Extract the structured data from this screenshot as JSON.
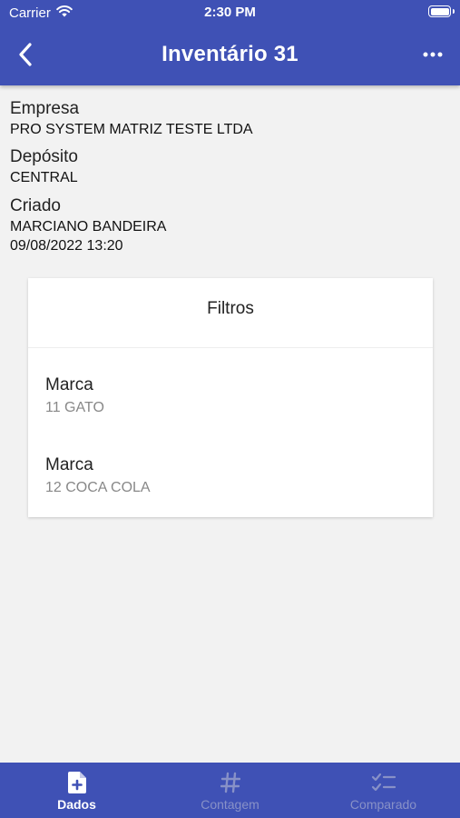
{
  "status_bar": {
    "carrier": "Carrier",
    "time": "2:30 PM"
  },
  "header": {
    "title": "Inventário 31",
    "back_icon": "chevron-left-icon",
    "more_icon": "more-horizontal-icon"
  },
  "info": {
    "empresa_label": "Empresa",
    "empresa_value": "PRO SYSTEM MATRIZ TESTE LTDA",
    "deposito_label": "Depósito",
    "deposito_value": "CENTRAL",
    "criado_label": "Criado",
    "criado_user": "MARCIANO BANDEIRA",
    "criado_date": "09/08/2022 13:20"
  },
  "filters": {
    "title": "Filtros",
    "items": [
      {
        "label": "Marca",
        "value": "11 GATO"
      },
      {
        "label": "Marca",
        "value": "12 COCA COLA"
      }
    ]
  },
  "tabs": [
    {
      "label": "Dados",
      "icon": "document-plus-icon",
      "active": true
    },
    {
      "label": "Contagem",
      "icon": "hash-icon",
      "active": false
    },
    {
      "label": "Comparado",
      "icon": "checklist-icon",
      "active": false
    }
  ],
  "colors": {
    "primary": "#3f51b5",
    "background": "#f2f2f2",
    "card": "#ffffff",
    "inactive_tab": "#8891c7"
  }
}
